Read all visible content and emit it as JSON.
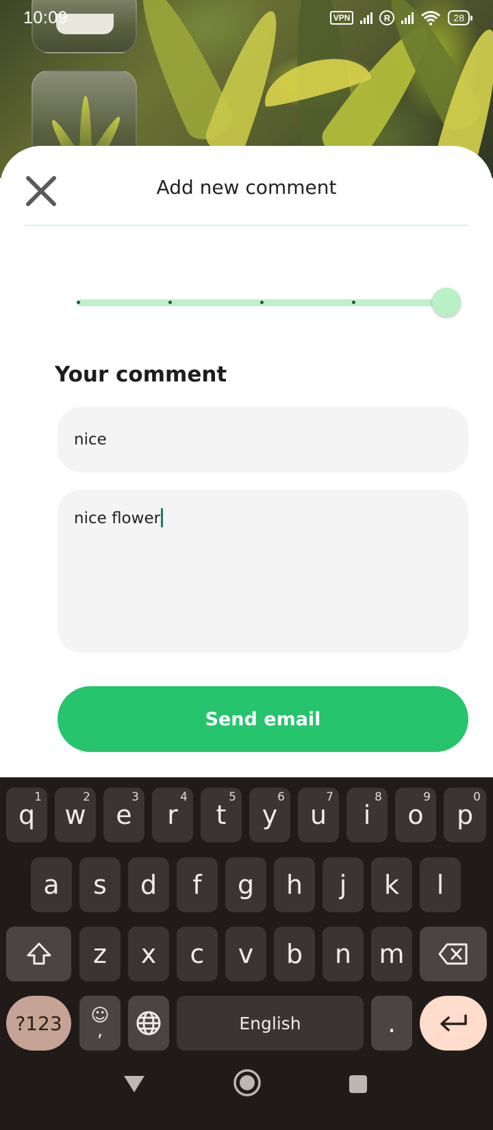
{
  "status_bar": {
    "time": "10:09",
    "vpn_label": "VPN",
    "roaming_badge": "R",
    "battery": "28"
  },
  "sheet": {
    "title": "Add new comment",
    "rating": 5,
    "rating_max": 5,
    "section_title": "Your comment",
    "subject_value": "nice",
    "body_value": "nice flower",
    "send_label": "Send email"
  },
  "colors": {
    "accent": "#26c46d",
    "slider_track": "#bff0cb",
    "keyboard_bg": "#201b19"
  },
  "keyboard": {
    "row1": [
      {
        "key": "q",
        "hint": "1"
      },
      {
        "key": "w",
        "hint": "2"
      },
      {
        "key": "e",
        "hint": "3"
      },
      {
        "key": "r",
        "hint": "4"
      },
      {
        "key": "t",
        "hint": "5"
      },
      {
        "key": "y",
        "hint": "6"
      },
      {
        "key": "u",
        "hint": "7"
      },
      {
        "key": "i",
        "hint": "8"
      },
      {
        "key": "o",
        "hint": "9"
      },
      {
        "key": "p",
        "hint": "0"
      }
    ],
    "row2": [
      "a",
      "s",
      "d",
      "f",
      "g",
      "h",
      "j",
      "k",
      "l"
    ],
    "row3": [
      "z",
      "x",
      "c",
      "v",
      "b",
      "n",
      "m"
    ],
    "symbols_label": "?123",
    "emoji_label": "☺",
    "comma_label": ",",
    "space_label": "English",
    "period_label": "."
  }
}
